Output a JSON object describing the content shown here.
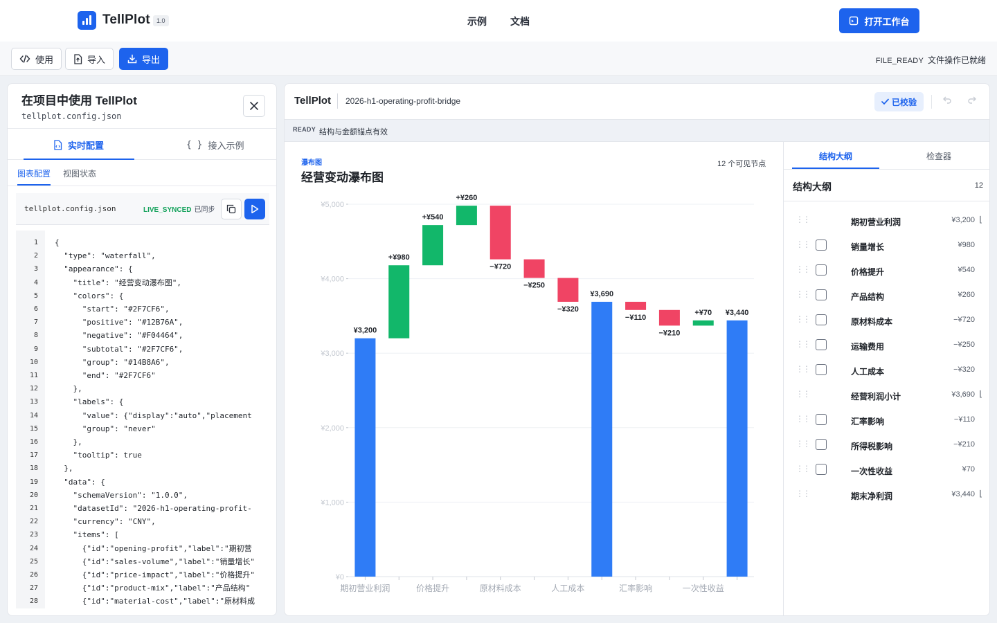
{
  "app": {
    "name": "TellPlot",
    "version": "1.0"
  },
  "nav": {
    "links": [
      "示例",
      "文档"
    ],
    "open_workspace": "打开工作台"
  },
  "toolbar": {
    "use": "使用",
    "import": "导入",
    "export": "导出",
    "status_code": "FILE_READY",
    "status_text": "文件操作已就绪"
  },
  "left_panel": {
    "title": "在项目中使用 TellPlot",
    "subtitle": "tellplot.config.json",
    "tabs": [
      "实时配置",
      "接入示例"
    ],
    "subtabs": [
      "图表配置",
      "视图状态"
    ],
    "code_header": {
      "file": "tellplot.config.json",
      "sync_code": "LIVE_SYNCED",
      "sync_text": "已同步"
    },
    "code_lines": [
      "{",
      "  \"type\": \"waterfall\",",
      "  \"appearance\": {",
      "    \"title\": \"经营变动瀑布图\",",
      "    \"colors\": {",
      "      \"start\": \"#2F7CF6\",",
      "      \"positive\": \"#12B76A\",",
      "      \"negative\": \"#F04464\",",
      "      \"subtotal\": \"#2F7CF6\",",
      "      \"group\": \"#14B8A6\",",
      "      \"end\": \"#2F7CF6\"",
      "    },",
      "    \"labels\": {",
      "      \"value\": {\"display\":\"auto\",\"placement",
      "      \"group\": \"never\"",
      "    },",
      "    \"tooltip\": true",
      "  },",
      "  \"data\": {",
      "    \"schemaVersion\": \"1.0.0\",",
      "    \"datasetId\": \"2026-h1-operating-profit-",
      "    \"currency\": \"CNY\",",
      "    \"items\": [",
      "      {\"id\":\"opening-profit\",\"label\":\"期初营",
      "      {\"id\":\"sales-volume\",\"label\":\"销量增长\"",
      "      {\"id\":\"price-impact\",\"label\":\"价格提升\"",
      "      {\"id\":\"product-mix\",\"label\":\"产品结构\"",
      "      {\"id\":\"material-cost\",\"label\":\"原材料成"
    ]
  },
  "main_panel": {
    "brand": "TellPlot",
    "dataset": "2026-h1-operating-profit-bridge",
    "verified": "已校验",
    "ready_code": "READY",
    "ready_text": "结构与金额锚点有效",
    "chart_kicker": "瀑布图",
    "chart_title": "经营变动瀑布图",
    "node_count": "12 个可见节点"
  },
  "chart_data": {
    "type": "bar",
    "subtype": "waterfall",
    "title": "经营变动瀑布图",
    "ylim": [
      0,
      5000
    ],
    "yticks": [
      "¥0",
      "¥1,000",
      "¥2,000",
      "¥3,000",
      "¥4,000",
      "¥5,000"
    ],
    "categories": [
      "期初营业利润",
      "销量增长",
      "价格提升",
      "产品结构",
      "原材料成本",
      "运输费用",
      "人工成本",
      "经营利润小计",
      "汇率影响",
      "所得税影响",
      "一次性收益",
      "期末净利润"
    ],
    "x_tick_labels": [
      "期初营业利润",
      "价格提升",
      "原材料成本",
      "人工成本",
      "汇率影响",
      "一次性收益"
    ],
    "items": [
      {
        "label": "期初营业利润",
        "kind": "start",
        "value": 3200,
        "display": "¥3,200"
      },
      {
        "label": "销量增长",
        "kind": "delta",
        "value": 980,
        "display": "+¥980"
      },
      {
        "label": "价格提升",
        "kind": "delta",
        "value": 540,
        "display": "+¥540"
      },
      {
        "label": "产品结构",
        "kind": "delta",
        "value": 260,
        "display": "+¥260"
      },
      {
        "label": "原材料成本",
        "kind": "delta",
        "value": -720,
        "display": "−¥720"
      },
      {
        "label": "运输费用",
        "kind": "delta",
        "value": -250,
        "display": "−¥250"
      },
      {
        "label": "人工成本",
        "kind": "delta",
        "value": -320,
        "display": "−¥320"
      },
      {
        "label": "经营利润小计",
        "kind": "subtotal",
        "value": 3690,
        "display": "¥3,690"
      },
      {
        "label": "汇率影响",
        "kind": "delta",
        "value": -110,
        "display": "−¥110"
      },
      {
        "label": "所得税影响",
        "kind": "delta",
        "value": -210,
        "display": "−¥210"
      },
      {
        "label": "一次性收益",
        "kind": "delta",
        "value": 70,
        "display": "+¥70"
      },
      {
        "label": "期末净利润",
        "kind": "end",
        "value": 3440,
        "display": "¥3,440"
      }
    ],
    "colors": {
      "start": "#2F7CF6",
      "positive": "#12B76A",
      "negative": "#F04464",
      "subtotal": "#2F7CF6",
      "end": "#2F7CF6"
    },
    "grid": true
  },
  "outline": {
    "tabs": [
      "结构大纲",
      "检查器"
    ],
    "header": "结构大纲",
    "count": "12",
    "rows": [
      {
        "label": "期初营业利润",
        "value": "¥3,200",
        "checkbox": false,
        "anchor": true
      },
      {
        "label": "销量增长",
        "value": "¥980",
        "checkbox": true,
        "anchor": false
      },
      {
        "label": "价格提升",
        "value": "¥540",
        "checkbox": true,
        "anchor": false
      },
      {
        "label": "产品结构",
        "value": "¥260",
        "checkbox": true,
        "anchor": false
      },
      {
        "label": "原材料成本",
        "value": "−¥720",
        "checkbox": true,
        "anchor": false
      },
      {
        "label": "运输费用",
        "value": "−¥250",
        "checkbox": true,
        "anchor": false
      },
      {
        "label": "人工成本",
        "value": "−¥320",
        "checkbox": true,
        "anchor": false
      },
      {
        "label": "经营利润小计",
        "value": "¥3,690",
        "checkbox": false,
        "anchor": true
      },
      {
        "label": "汇率影响",
        "value": "−¥110",
        "checkbox": true,
        "anchor": false
      },
      {
        "label": "所得税影响",
        "value": "−¥210",
        "checkbox": true,
        "anchor": false
      },
      {
        "label": "一次性收益",
        "value": "¥70",
        "checkbox": true,
        "anchor": false
      },
      {
        "label": "期末净利润",
        "value": "¥3,440",
        "checkbox": false,
        "anchor": true
      }
    ]
  }
}
